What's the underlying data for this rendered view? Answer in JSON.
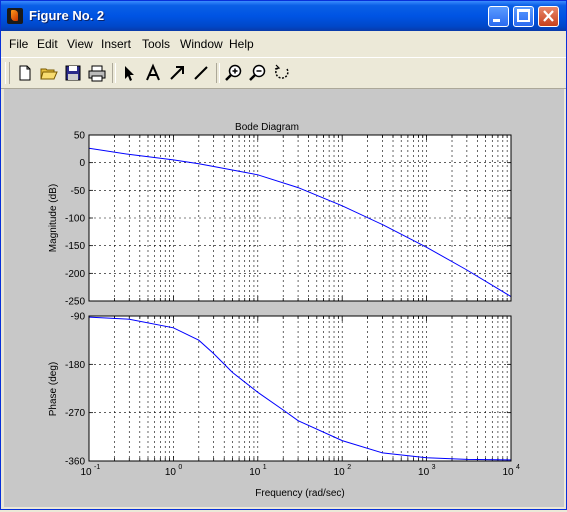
{
  "window": {
    "title": "Figure No. 2"
  },
  "menu": [
    "File",
    "Edit",
    "View",
    "Insert",
    "Tools",
    "Window",
    "Help"
  ],
  "toolbar": {
    "tools": [
      "new-file-icon",
      "open-folder-icon",
      "save-icon",
      "print-icon",
      "select-arrow-icon",
      "insert-text-icon",
      "insert-arrow-icon",
      "insert-line-icon",
      "zoom-in-icon",
      "zoom-out-icon",
      "rotate-icon"
    ]
  },
  "plot": {
    "title": "Bode Diagram",
    "xlabel": "Frequency  (rad/sec)",
    "mag_ylabel": "Magnitude (dB)",
    "phase_ylabel": "Phase (deg)",
    "mag_ticks": [
      "50",
      "0",
      "-50",
      "-100",
      "-150",
      "-200",
      "-250"
    ],
    "phase_ticks": [
      "-90",
      "-180",
      "-270",
      "-360"
    ],
    "x_ticks_base": "10",
    "x_ticks_exp": [
      "-1",
      "0",
      "1",
      "2",
      "3",
      "4"
    ]
  },
  "chart_data": [
    {
      "type": "line",
      "title": "Bode Diagram",
      "ylabel": "Magnitude (dB)",
      "xscale": "log",
      "xlim": [
        0.1,
        10000
      ],
      "ylim": [
        -250,
        50
      ],
      "grid": true,
      "series": [
        {
          "color": "#0000ff",
          "x": [
            0.1,
            0.3,
            1,
            2,
            3,
            10,
            30,
            100,
            300,
            1000,
            3000,
            10000
          ],
          "y": [
            26,
            15,
            5,
            -2,
            -7,
            -22,
            -45,
            -78,
            -112,
            -153,
            -194,
            -242
          ]
        }
      ]
    },
    {
      "type": "line",
      "ylabel": "Phase (deg)",
      "xlabel": "Frequency  (rad/sec)",
      "xscale": "log",
      "xlim": [
        0.1,
        10000
      ],
      "ylim": [
        -360,
        -90
      ],
      "grid": true,
      "series": [
        {
          "color": "#0000ff",
          "x": [
            0.1,
            0.3,
            1,
            2,
            3,
            5,
            10,
            20,
            30,
            100,
            300,
            1000,
            3000,
            10000
          ],
          "y": [
            -92,
            -96,
            -112,
            -135,
            -160,
            -195,
            -232,
            -265,
            -285,
            -322,
            -345,
            -354,
            -357,
            -358
          ]
        }
      ]
    }
  ]
}
